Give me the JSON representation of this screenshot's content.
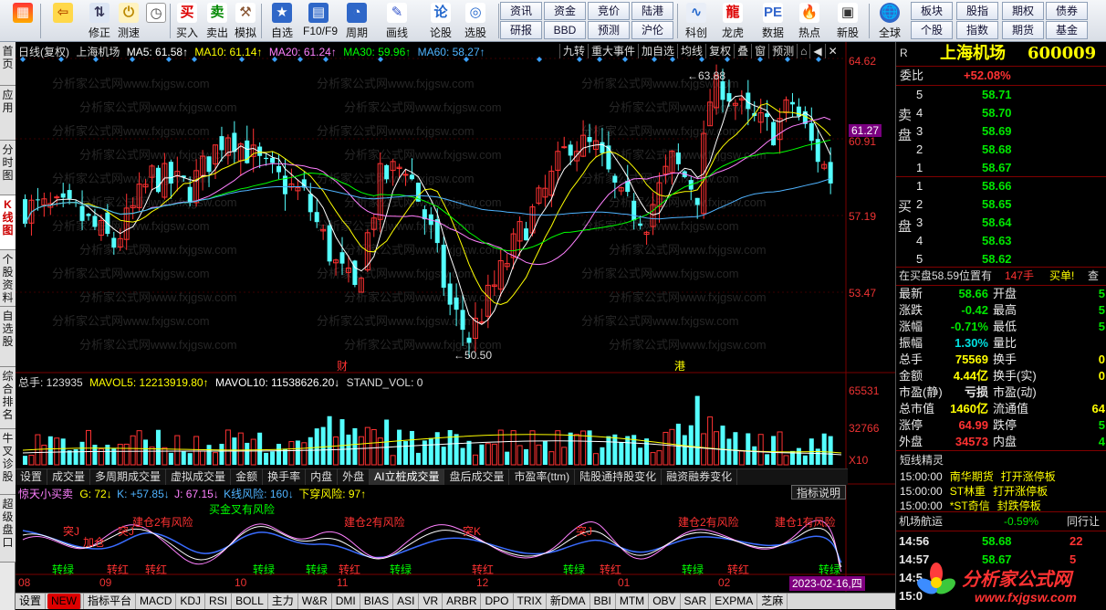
{
  "toolbar": {
    "buttons": [
      {
        "label": "",
        "icon": "windows-icon"
      },
      {
        "label": "",
        "icon": "back-arrow-icon"
      },
      {
        "label": "修正",
        "icon": "up-down-icon"
      },
      {
        "label": "测速",
        "icon": "speed-icon"
      },
      {
        "label": "",
        "icon": "clock-icon"
      },
      {
        "label": "买入",
        "icon": "buy-icon"
      },
      {
        "label": "卖出",
        "icon": "sell-icon"
      },
      {
        "label": "模拟",
        "icon": "hammer-icon"
      },
      {
        "label": "自选",
        "icon": "star-icon"
      },
      {
        "label": "F10/F9",
        "icon": "f10-icon"
      },
      {
        "label": "周期",
        "icon": "period-icon"
      },
      {
        "label": "画线",
        "icon": "pen-icon"
      },
      {
        "label": "论股",
        "icon": "discuss-icon"
      },
      {
        "label": "选股",
        "icon": "select-icon"
      },
      {
        "label": "科创",
        "icon": "kechuang-icon"
      },
      {
        "label": "龙虎",
        "icon": "dragon-icon"
      },
      {
        "label": "数据",
        "icon": "data-icon"
      },
      {
        "label": "热点",
        "icon": "hot-icon"
      },
      {
        "label": "新股",
        "icon": "new-stock-icon"
      },
      {
        "label": "全球",
        "icon": "globe-icon"
      }
    ],
    "small_buttons": [
      {
        "top": "资讯",
        "bottom": "研报"
      },
      {
        "top": "资金",
        "bottom": "BBD"
      },
      {
        "top": "竞价",
        "bottom": "预测"
      },
      {
        "top": "陆港",
        "bottom": "沪伦"
      },
      {
        "top": "板块",
        "bottom": "个股"
      },
      {
        "top": "股指",
        "bottom": "指数"
      },
      {
        "top": "期权",
        "bottom": "期货"
      },
      {
        "top": "债券",
        "bottom": "基金"
      }
    ]
  },
  "left_tabs": [
    "首页",
    "应用",
    "分时图",
    "K线图",
    "个股资料",
    "自选股",
    "综合排名",
    "牛叉诊股",
    "超级盘口"
  ],
  "chart_header": {
    "period": "日线(复权)",
    "stock_name": "上海机场",
    "ma5": "MA5: 61.58",
    "ma10": "MA10: 61.14",
    "ma20": "MA20: 61.24",
    "ma30": "MA30: 59.96",
    "ma60": "MA60: 58.27",
    "tools": [
      "九转",
      "重大事件",
      "加自选",
      "均线",
      "复权",
      "叠",
      "窗",
      "预测",
      "⌂",
      "◀",
      "✕"
    ]
  },
  "price_axis": [
    "64.62",
    "61.27",
    "60.91",
    "57.19",
    "53.47"
  ],
  "annotations": {
    "high": "63.88",
    "low": "50.50",
    "marker1": "财",
    "marker2": "港"
  },
  "volume_header": {
    "total": "总手: 123935",
    "mavol5": "MAVOL5: 12213919.80",
    "mavol10": "MAVOL10: 11538626.20",
    "stand": "STAND_VOL: 0"
  },
  "volume_axis": [
    "65531",
    "32766",
    "X10"
  ],
  "sub_tabs": [
    "设置",
    "成交量",
    "多周期成交量",
    "虚拟成交量",
    "金额",
    "换手率",
    "内盘",
    "外盘",
    "AI立桩成交量",
    "盘后成交量",
    "市盈率(ttm)",
    "陆股通持股变化",
    "融资融券变化"
  ],
  "indicator": {
    "title": "惊天小买卖",
    "g": "G: 72",
    "k": "K: +57.85",
    "j": "J: 67.15",
    "kline_risk": "K线风险: 160",
    "shadow_risk": "下穿风险: 97",
    "help": "指标说明",
    "labels": [
      {
        "t": "买金叉有风险",
        "c": "#00ff00"
      },
      {
        "t": "建仓2有风险",
        "c": "#ff3232"
      },
      {
        "t": "建仓2有风险",
        "c": "#ff3232"
      },
      {
        "t": "建仓2有风险",
        "c": "#ff3232"
      },
      {
        "t": "建仓1有风险",
        "c": "#ff3232"
      },
      {
        "t": "突J",
        "c": "#ff3232"
      },
      {
        "t": "突J",
        "c": "#ff3232"
      },
      {
        "t": "突K",
        "c": "#ff3232"
      },
      {
        "t": "突J",
        "c": "#ff3232"
      },
      {
        "t": "加仓",
        "c": "#ff3232"
      },
      {
        "t": "转红",
        "c": "#ff3232"
      },
      {
        "t": "转绿",
        "c": "#00ff00"
      }
    ]
  },
  "time_axis": [
    "08",
    "09",
    "10",
    "11",
    "12",
    "01",
    "02"
  ],
  "date_cursor": "2023-02-16,四",
  "bottom_tabs": [
    "设置",
    "NEW",
    "指标平台",
    "MACD",
    "KDJ",
    "RSI",
    "BOLL",
    "主力",
    "W&R",
    "DMI",
    "BIAS",
    "ASI",
    "VR",
    "ARBR",
    "DPO",
    "TRIX",
    "新DMA",
    "BBI",
    "MTM",
    "OBV",
    "SAR",
    "EXPMA",
    "芝麻"
  ],
  "quote": {
    "r_mark": "R",
    "name": "上海机场",
    "code": "600009",
    "weibi_label": "委比",
    "weibi": "+52.08%",
    "sell_label": "卖盘",
    "buy_label": "买盘",
    "sells": [
      {
        "n": "5",
        "p": "58.71"
      },
      {
        "n": "4",
        "p": "58.70"
      },
      {
        "n": "3",
        "p": "58.69"
      },
      {
        "n": "2",
        "p": "58.68"
      },
      {
        "n": "1",
        "p": "58.67"
      }
    ],
    "buys": [
      {
        "n": "1",
        "p": "58.66"
      },
      {
        "n": "2",
        "p": "58.65"
      },
      {
        "n": "3",
        "p": "58.64"
      },
      {
        "n": "4",
        "p": "58.63"
      },
      {
        "n": "5",
        "p": "58.62"
      }
    ],
    "info_line": "在买盘58.59位置有",
    "info_qty": "147手",
    "info_tip": "买单!",
    "info_check": "查",
    "stats": [
      {
        "l": "最新",
        "v": "58.66",
        "vc": "green",
        "l2": "开盘",
        "v2": "5"
      },
      {
        "l": "涨跌",
        "v": "-0.42",
        "vc": "green",
        "l2": "最高",
        "v2": "5"
      },
      {
        "l": "涨幅",
        "v": "-0.71%",
        "vc": "green",
        "l2": "最低",
        "v2": "5"
      },
      {
        "l": "振幅",
        "v": "1.30%",
        "vc": "cyan",
        "l2": "量比",
        "v2": ""
      },
      {
        "l": "总手",
        "v": "75569",
        "vc": "yellow",
        "l2": "换手",
        "v2": "0"
      },
      {
        "l": "金额",
        "v": "4.44亿",
        "vc": "yellow",
        "l2": "换手(实)",
        "v2": "0"
      },
      {
        "l": "市盈(静)",
        "v": "亏损",
        "vc": "white",
        "l2": "市盈(动)",
        "v2": ""
      },
      {
        "l": "总市值",
        "v": "1460亿",
        "vc": "yellow",
        "l2": "流通值",
        "v2": "64"
      },
      {
        "l": "涨停",
        "v": "64.99",
        "vc": "red",
        "l2": "跌停",
        "v2": "5"
      },
      {
        "l": "外盘",
        "v": "34573",
        "vc": "red",
        "l2": "内盘",
        "v2": "4"
      }
    ]
  },
  "news": {
    "title": "短线精灵",
    "items": [
      {
        "time": "15:00:00",
        "name": "南华期货",
        "event": "打开涨停板"
      },
      {
        "time": "15:00:00",
        "name": "ST林重",
        "event": "打开涨停板"
      },
      {
        "time": "15:00:00",
        "name": "*ST奇信",
        "event": "封跌停板"
      }
    ]
  },
  "aviation": {
    "title": "机场航运",
    "change": "-0.59%",
    "peer": "同行让"
  },
  "ticks": [
    {
      "t": "14:56",
      "p": "58.68",
      "q": "22"
    },
    {
      "t": "14:57",
      "p": "58.67",
      "q": "5"
    },
    {
      "t": "14:5",
      "p": "",
      "q": ""
    },
    {
      "t": "15:0",
      "p": "",
      "q": ""
    }
  ],
  "brand": {
    "name": "分析家公式网",
    "url": "www.fxjgsw.com"
  },
  "watermark": "分析家公式网www.fxjgsw.com",
  "colors": {
    "up": "#ff3232",
    "down": "#54ffff",
    "ma5": "#ffffff",
    "ma10": "#ffff00",
    "ma20": "#ff80ff",
    "ma30": "#00ff00",
    "ma60": "#4fb3ff"
  }
}
